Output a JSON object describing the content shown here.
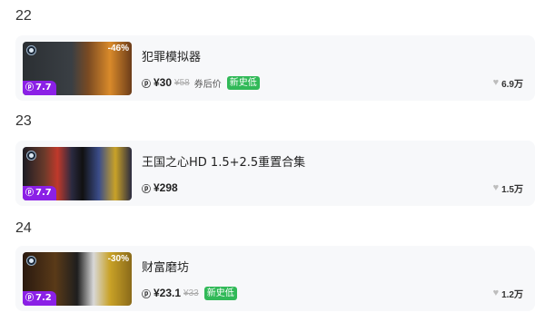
{
  "items": [
    {
      "rank": "22",
      "title": "犯罪模拟器",
      "discount": "-46%",
      "event_badge": "7.7",
      "price": "¥30",
      "original_price": "¥58",
      "coupon_note": "券后价",
      "lowest_tag": "新史低",
      "likes": "6.9万"
    },
    {
      "rank": "23",
      "title": "王国之心HD 1.5+2.5重置合集",
      "discount": "",
      "event_badge": "7.7",
      "price": "¥298",
      "original_price": "",
      "coupon_note": "",
      "lowest_tag": "",
      "likes": "1.5万"
    },
    {
      "rank": "24",
      "title": "财富磨坊",
      "discount": "-30%",
      "event_badge": "7.2",
      "price": "¥23.1",
      "original_price": "¥33",
      "coupon_note": "",
      "lowest_tag": "新史低",
      "likes": "1.2万"
    }
  ],
  "icons": {
    "platform": "steam-icon",
    "price_mark": "pm-icon",
    "like": "heart-icon"
  },
  "colors": {
    "event_badge": "#8b20e6",
    "lowest_tag": "#31b958",
    "card_bg": "#f7f8fa"
  }
}
